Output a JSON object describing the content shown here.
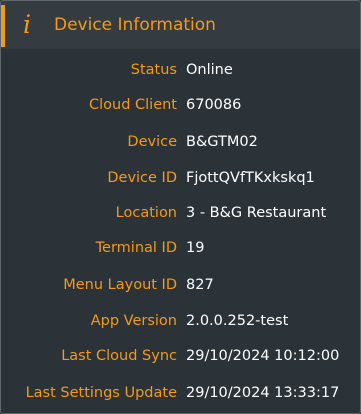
{
  "header": {
    "icon": "info-icon",
    "title": "Device Information"
  },
  "colors": {
    "accent": "#f39a18",
    "background": "#2c3338",
    "header_background": "#343c42",
    "value_text": "#ffffff"
  },
  "fields": [
    {
      "label": "Status",
      "value": "Online"
    },
    {
      "label": "Cloud Client",
      "value": "670086"
    },
    {
      "label": "Device",
      "value": "B&GTM02"
    },
    {
      "label": "Device ID",
      "value": "FjottQVfTKxkskq1"
    },
    {
      "label": "Location",
      "value": "3 - B&G Restaurant"
    },
    {
      "label": "Terminal ID",
      "value": "19"
    },
    {
      "label": "Menu Layout ID",
      "value": "827"
    },
    {
      "label": "App Version",
      "value": "2.0.0.252-test"
    },
    {
      "label": "Last Cloud Sync",
      "value": "29/10/2024 10:12:00"
    },
    {
      "label": "Last Settings Update",
      "value": "29/10/2024 13:33:17"
    }
  ]
}
